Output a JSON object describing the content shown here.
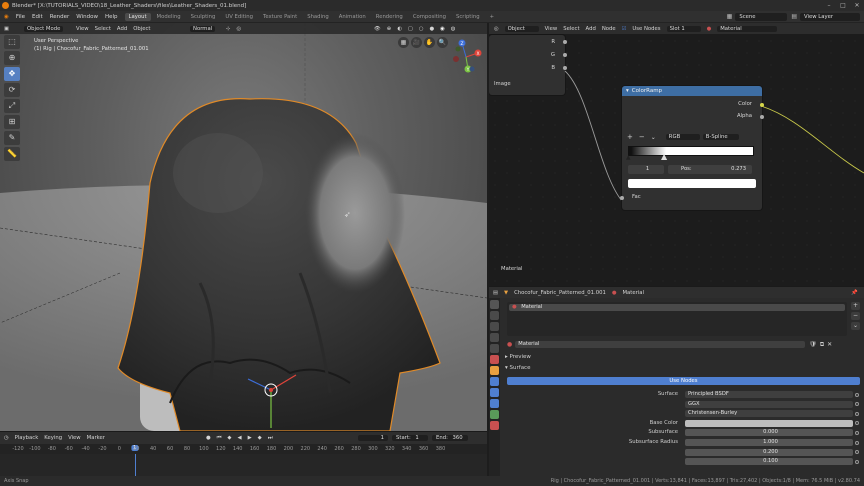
{
  "window": {
    "title": "Blender* [X:\\TUTORIALS_VIDEO\\18_Leather_Shaders\\files\\Leather_Shaders_01.blend]"
  },
  "topbar": {
    "menus": [
      "File",
      "Edit",
      "Render",
      "Window",
      "Help"
    ],
    "workspaces": [
      "Layout",
      "Modeling",
      "Sculpting",
      "UV Editing",
      "Texture Paint",
      "Shading",
      "Animation",
      "Rendering",
      "Compositing",
      "Scripting"
    ],
    "active_workspace": "Layout",
    "add_tab": "+",
    "scene": "Scene",
    "view_layer": "View Layer"
  },
  "viewport": {
    "mode": "Object Mode",
    "menus": [
      "View",
      "Select",
      "Add",
      "Object"
    ],
    "orientation": "Normal",
    "info_line1": "User Perspective",
    "info_line2": "(1) Rig | Chocofur_Fabric_Patterned_01.001",
    "gizmo_axes": {
      "x": "X",
      "y": "Y",
      "z": "Z"
    },
    "tools": [
      "select",
      "cursor",
      "move",
      "rotate",
      "scale",
      "transform",
      "annotate",
      "measure"
    ]
  },
  "timeline": {
    "menus": [
      "Playback",
      "Keying",
      "View",
      "Marker"
    ],
    "current_frame": "1",
    "start_label": "Start:",
    "start_value": "1",
    "end_label": "End:",
    "end_value": "360",
    "ticks": [
      "-120",
      "-100",
      "-80",
      "-60",
      "-40",
      "-20",
      "0",
      "1",
      "20",
      "40",
      "60",
      "80",
      "100",
      "120",
      "140",
      "160",
      "180",
      "200",
      "220",
      "240",
      "260",
      "280",
      "300",
      "320",
      "340",
      "360",
      "380"
    ]
  },
  "node_editor": {
    "header_items": [
      "Object",
      "View",
      "Select",
      "Add",
      "Node"
    ],
    "use_nodes_label": "Use Nodes",
    "slot": "Slot 1",
    "material": "Material",
    "image_node": {
      "outputs": [
        "R",
        "G",
        "B"
      ],
      "label": "Image"
    },
    "colorramp": {
      "title": "ColorRamp",
      "outputs": [
        "Color",
        "Alpha"
      ],
      "color_mode": "RGB",
      "interpolation": "B-Spline",
      "add": "+",
      "remove": "−",
      "menu": "⌄",
      "index": "1",
      "pos_label": "Pos:",
      "pos_value": "0.273",
      "input": "Fac"
    },
    "material_label": "Material"
  },
  "properties": {
    "object_name": "Chocofur_Fabric_Patterned_01.001",
    "material_tab": "Material",
    "slot_item": "Material",
    "material_name": "Material",
    "sections": {
      "preview": "Preview",
      "surface": "Surface"
    },
    "use_nodes_button": "Use Nodes",
    "rows": [
      {
        "label": "Surface",
        "value": "Principled BSDF"
      },
      {
        "label": "",
        "value": "GGX"
      },
      {
        "label": "",
        "value": "Christensen-Burley"
      },
      {
        "label": "Base Color",
        "value": ""
      },
      {
        "label": "Subsurface",
        "value": "0.000"
      },
      {
        "label": "Subsurface Radius",
        "value": "1.000"
      },
      {
        "label": "",
        "value": "0.200"
      },
      {
        "label": "",
        "value": "0.100"
      }
    ]
  },
  "statusbar": {
    "left": "Axis Snap",
    "right": "Rig | Chocofur_Fabric_Patterned_01.001 | Verts:13,841 | Faces:13,897 | Tris:27,402 | Objects:1/8 | Mem: 76.5 MiB | v2.80.74"
  },
  "colors": {
    "accent": "#4f7fd0",
    "orange": "#e87d0d",
    "colorramp_header": "#3e6ea4"
  }
}
